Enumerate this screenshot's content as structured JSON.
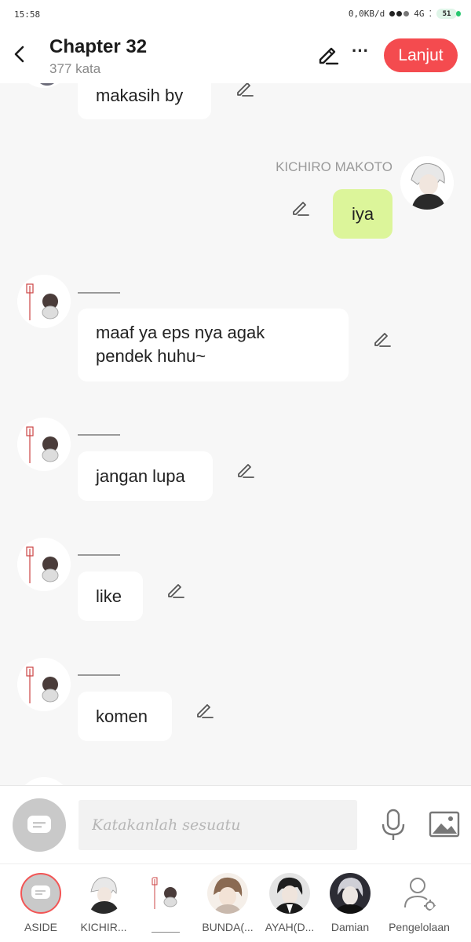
{
  "status_bar": {
    "time": "15:58",
    "network_speed": "0,0KB/d",
    "network_type": "4G",
    "battery": "51"
  },
  "header": {
    "title": "Chapter 32",
    "word_count": "377 kata",
    "continue_label": "Lanjut",
    "accent_color": "#f44b4f"
  },
  "messages": [
    {
      "speaker": "",
      "text": "makasih by",
      "side": "left",
      "avatar": "iv-drip-chibi"
    },
    {
      "speaker": "KICHIRO MAKOTO",
      "text": "iya",
      "side": "right",
      "avatar": "white-haired-boy"
    },
    {
      "speaker": "",
      "text_lines": [
        "maaf ya eps nya agak",
        "pendek huhu~"
      ],
      "side": "left",
      "avatar": "iv-drip-chibi"
    },
    {
      "speaker": "",
      "text": "jangan lupa",
      "side": "left",
      "avatar": "iv-drip-chibi"
    },
    {
      "speaker": "",
      "text": "like",
      "side": "left",
      "avatar": "iv-drip-chibi"
    },
    {
      "speaker": "",
      "text": "komen",
      "side": "left",
      "avatar": "iv-drip-chibi"
    }
  ],
  "input": {
    "placeholder": "Katakanlah sesuatu"
  },
  "characters": [
    {
      "label": "ASIDE",
      "avatar": "chat-bubble-icon",
      "selected": true
    },
    {
      "label": "KICHIR...",
      "avatar": "white-haired-boy"
    },
    {
      "label": "",
      "avatar": "iv-drip-chibi"
    },
    {
      "label": "BUNDA(...",
      "avatar": "brown-haired-person"
    },
    {
      "label": "AYAH(D...",
      "avatar": "dark-haired-man"
    },
    {
      "label": "Damian",
      "avatar": "pale-haired-man"
    },
    {
      "label": "Pengelolaan",
      "avatar": "manage-characters-icon"
    }
  ],
  "colors": {
    "my_bubble": "#dcf59a",
    "other_bubble": "#ffffff",
    "background": "#f7f7f7"
  }
}
